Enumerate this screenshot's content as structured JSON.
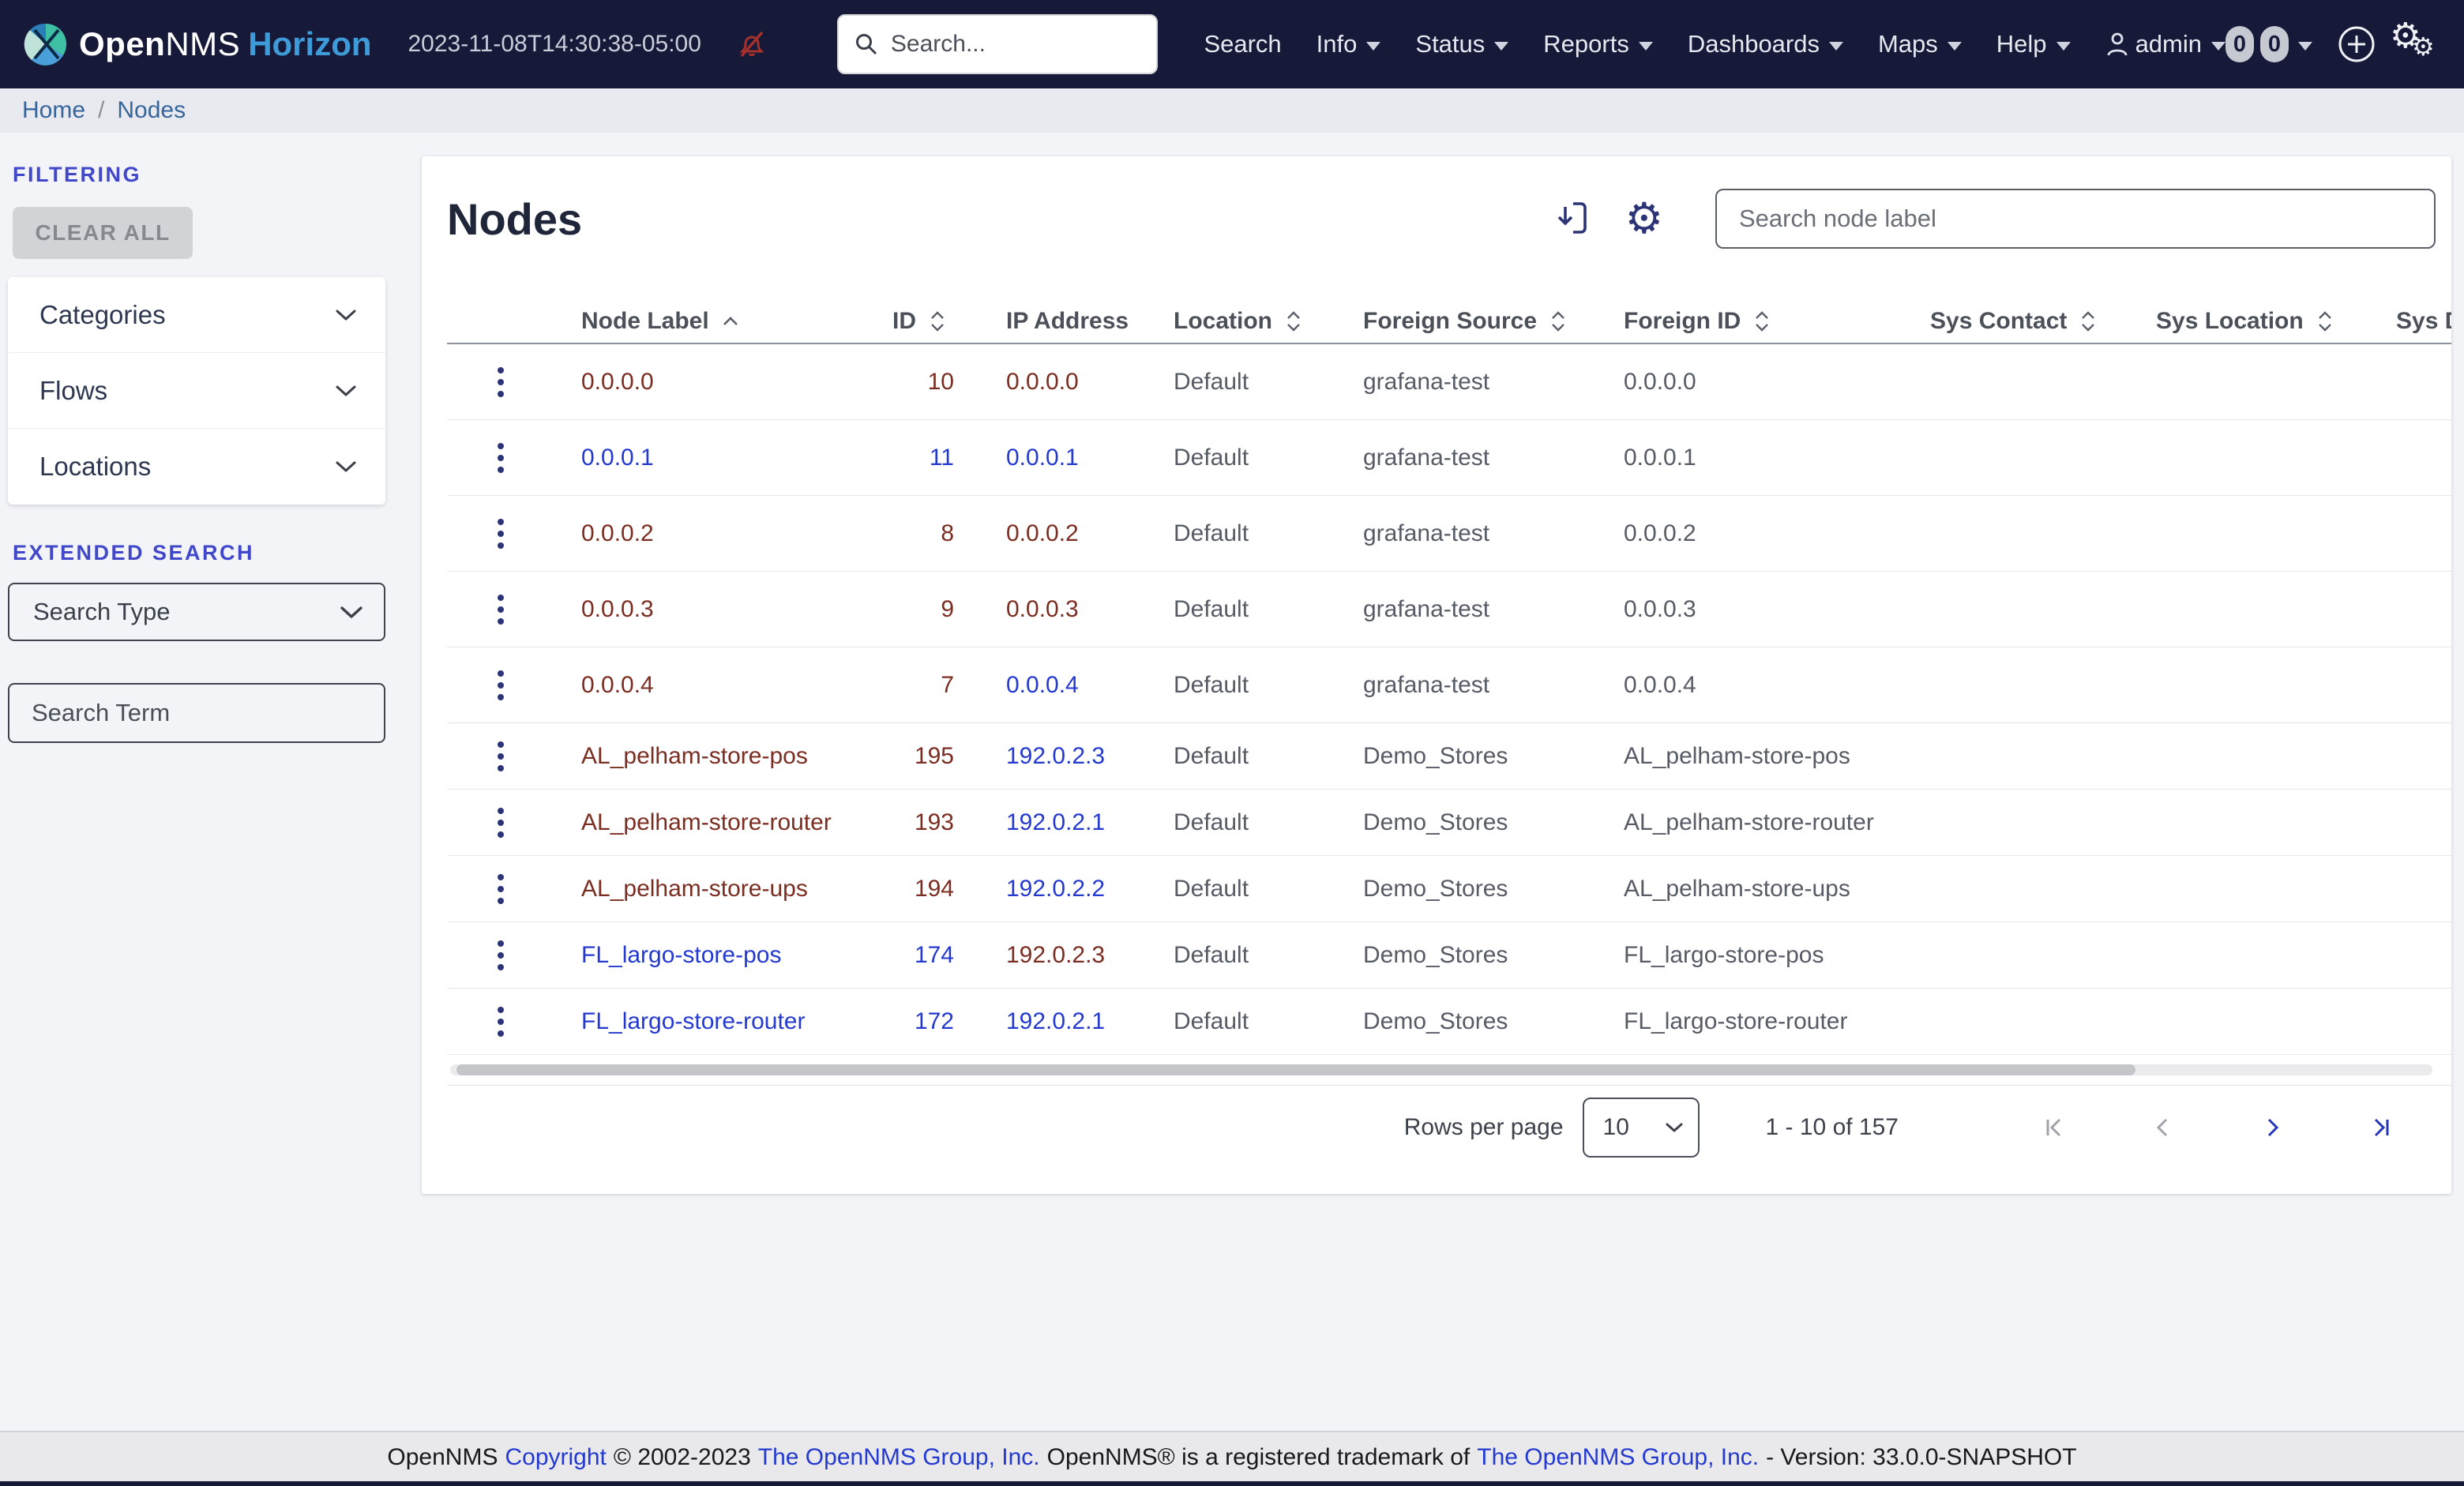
{
  "navbar": {
    "logo": {
      "open": "Open",
      "nms": "NMS",
      "product": "Horizon"
    },
    "timestamp": "2023-11-08T14:30:38-05:00",
    "search_placeholder": "Search...",
    "menu": [
      {
        "label": "Search",
        "caret": false
      },
      {
        "label": "Info",
        "caret": true
      },
      {
        "label": "Status",
        "caret": true
      },
      {
        "label": "Reports",
        "caret": true
      },
      {
        "label": "Dashboards",
        "caret": true
      },
      {
        "label": "Maps",
        "caret": true
      },
      {
        "label": "Help",
        "caret": true
      }
    ],
    "user": {
      "label": "admin"
    },
    "badges": [
      "0",
      "0"
    ],
    "icons": [
      "search-icon",
      "bell-slash-icon",
      "user-icon",
      "plus-circle-icon",
      "gears-icon"
    ]
  },
  "breadcrumb": {
    "home": "Home",
    "separator": "/",
    "current": "Nodes"
  },
  "sidebar": {
    "filtering_label": "FILTERING",
    "clear_all_label": "CLEAR ALL",
    "accordions": [
      "Categories",
      "Flows",
      "Locations"
    ],
    "extended_search_label": "EXTENDED SEARCH",
    "search_type_value": "Search Type",
    "search_term_placeholder": "Search Term"
  },
  "content": {
    "title": "Nodes",
    "toolbar": {
      "icons": [
        "export-icon",
        "gear-icon"
      ],
      "search_placeholder": "Search node label"
    },
    "table": {
      "columns": [
        {
          "label": "Node Label",
          "sort": "asc"
        },
        {
          "label": "ID",
          "sort": "both"
        },
        {
          "label": "IP Address",
          "sort": "none"
        },
        {
          "label": "Location",
          "sort": "both"
        },
        {
          "label": "Foreign Source",
          "sort": "both"
        },
        {
          "label": "Foreign ID",
          "sort": "both"
        },
        {
          "label": "Sys Contact",
          "sort": "both"
        },
        {
          "label": "Sys Location",
          "sort": "both"
        },
        {
          "label": "Sys D",
          "sort": "none"
        }
      ],
      "row_icon": "kebab-menu-icon",
      "rows": [
        {
          "label": "0.0.0.0",
          "label_state": "visited",
          "id": "10",
          "id_state": "visited",
          "ip": "0.0.0.0",
          "ip_state": "visited",
          "location": "Default",
          "foreign_source": "grafana-test",
          "foreign_id": "0.0.0.0",
          "sys_contact": "",
          "sys_location": ""
        },
        {
          "label": "0.0.0.1",
          "label_state": "new",
          "id": "11",
          "id_state": "new",
          "ip": "0.0.0.1",
          "ip_state": "new",
          "location": "Default",
          "foreign_source": "grafana-test",
          "foreign_id": "0.0.0.1",
          "sys_contact": "",
          "sys_location": ""
        },
        {
          "label": "0.0.0.2",
          "label_state": "visited",
          "id": "8",
          "id_state": "visited",
          "ip": "0.0.0.2",
          "ip_state": "visited",
          "location": "Default",
          "foreign_source": "grafana-test",
          "foreign_id": "0.0.0.2",
          "sys_contact": "",
          "sys_location": ""
        },
        {
          "label": "0.0.0.3",
          "label_state": "visited",
          "id": "9",
          "id_state": "visited",
          "ip": "0.0.0.3",
          "ip_state": "visited",
          "location": "Default",
          "foreign_source": "grafana-test",
          "foreign_id": "0.0.0.3",
          "sys_contact": "",
          "sys_location": ""
        },
        {
          "label": "0.0.0.4",
          "label_state": "visited",
          "id": "7",
          "id_state": "visited",
          "ip": "0.0.0.4",
          "ip_state": "new",
          "location": "Default",
          "foreign_source": "grafana-test",
          "foreign_id": "0.0.0.4",
          "sys_contact": "",
          "sys_location": ""
        },
        {
          "label": "AL_pelham-store-pos",
          "label_state": "visited",
          "id": "195",
          "id_state": "visited",
          "ip": "192.0.2.3",
          "ip_state": "new",
          "location": "Default",
          "foreign_source": "Demo_Stores",
          "foreign_id": "AL_pelham-store-pos",
          "sys_contact": "",
          "sys_location": ""
        },
        {
          "label": "AL_pelham-store-router",
          "label_state": "visited",
          "id": "193",
          "id_state": "visited",
          "ip": "192.0.2.1",
          "ip_state": "new",
          "location": "Default",
          "foreign_source": "Demo_Stores",
          "foreign_id": "AL_pelham-store-router",
          "sys_contact": "",
          "sys_location": ""
        },
        {
          "label": "AL_pelham-store-ups",
          "label_state": "visited",
          "id": "194",
          "id_state": "visited",
          "ip": "192.0.2.2",
          "ip_state": "new",
          "location": "Default",
          "foreign_source": "Demo_Stores",
          "foreign_id": "AL_pelham-store-ups",
          "sys_contact": "",
          "sys_location": ""
        },
        {
          "label": "FL_largo-store-pos",
          "label_state": "new",
          "id": "174",
          "id_state": "new",
          "ip": "192.0.2.3",
          "ip_state": "visited",
          "location": "Default",
          "foreign_source": "Demo_Stores",
          "foreign_id": "FL_largo-store-pos",
          "sys_contact": "",
          "sys_location": ""
        },
        {
          "label": "FL_largo-store-router",
          "label_state": "new",
          "id": "172",
          "id_state": "new",
          "ip": "192.0.2.1",
          "ip_state": "new",
          "location": "Default",
          "foreign_source": "Demo_Stores",
          "foreign_id": "FL_largo-store-router",
          "sys_contact": "",
          "sys_location": ""
        }
      ]
    },
    "pagination": {
      "rows_per_page_label": "Rows per page",
      "page_size": "10",
      "range": "1 - 10 of 157",
      "icons": [
        "first-page-icon",
        "prev-page-icon",
        "next-page-icon",
        "last-page-icon"
      ]
    }
  },
  "footer": {
    "pre": "OpenNMS",
    "copyright_link": "Copyright",
    "years": "© 2002-2023",
    "group_link": "The OpenNMS Group, Inc.",
    "trademark_text": "OpenNMS® is a registered trademark of",
    "group_link2": "The OpenNMS Group, Inc.",
    "version_text": "- Version: 33.0.0-SNAPSHOT"
  },
  "colors": {
    "navbar_bg": "#161a38",
    "accent_indigo": "#4147c9",
    "link_new": "#2339cf",
    "link_visited": "#7c2d21",
    "icon_navy": "#2c3377",
    "alert_red": "#a5312c",
    "horizon_blue": "#3f9bd8"
  }
}
